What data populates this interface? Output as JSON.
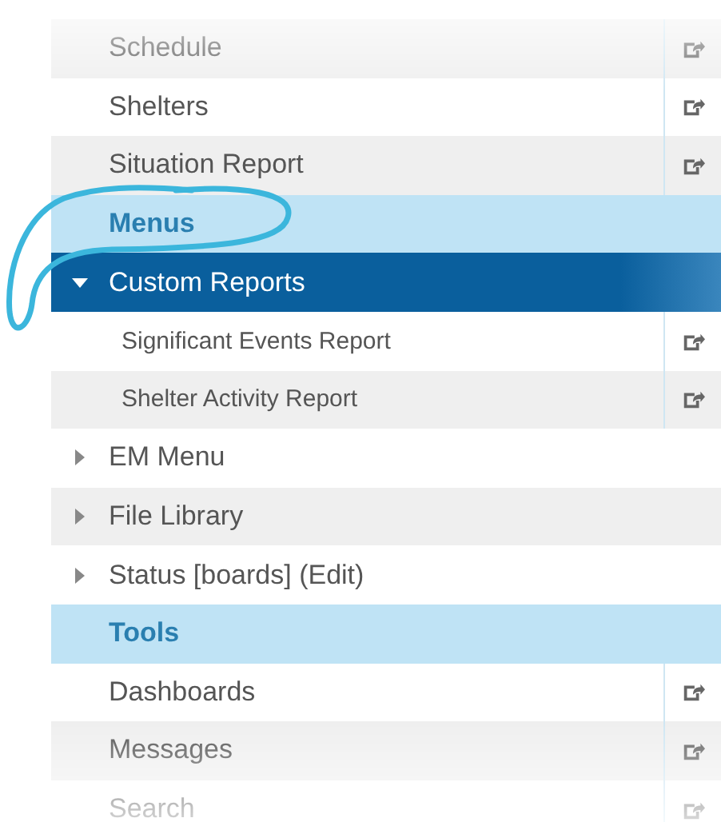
{
  "menu": {
    "items": [
      {
        "kind": "link",
        "label": "Schedule",
        "selected": false
      },
      {
        "kind": "link",
        "label": "Shelters",
        "selected": false
      },
      {
        "kind": "link",
        "label": "Situation Report",
        "selected": false
      },
      {
        "kind": "header",
        "label": "Menus"
      },
      {
        "kind": "folder",
        "label": "Custom Reports",
        "selected": true,
        "expanded": true,
        "children": [
          {
            "kind": "link",
            "label": "Significant Events Report",
            "selected": false
          },
          {
            "kind": "link",
            "label": "Shelter Activity Report",
            "selected": false
          }
        ]
      },
      {
        "kind": "folder",
        "label": "EM Menu",
        "selected": false,
        "expanded": false
      },
      {
        "kind": "folder",
        "label": "File Library",
        "selected": false,
        "expanded": false
      },
      {
        "kind": "folder",
        "label": "Status [boards] (Edit)",
        "selected": false,
        "expanded": false
      },
      {
        "kind": "header",
        "label": "Tools"
      },
      {
        "kind": "link",
        "label": "Dashboards",
        "selected": false
      },
      {
        "kind": "link",
        "label": "Messages",
        "selected": false
      },
      {
        "kind": "link",
        "label": "Search",
        "selected": false
      }
    ]
  }
}
